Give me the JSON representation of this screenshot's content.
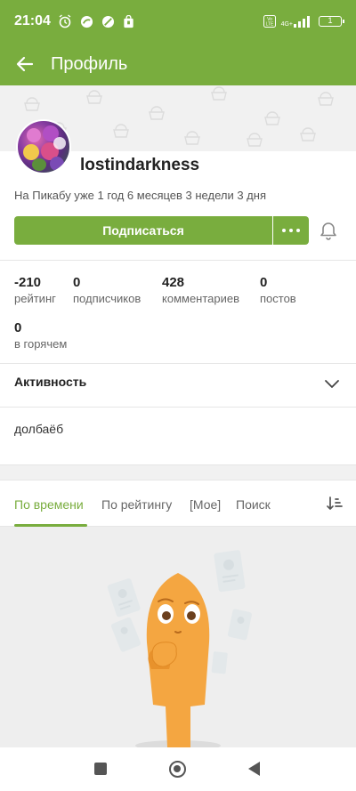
{
  "status_bar": {
    "time": "21:04",
    "signal_text": "4G+",
    "volte": "Vo LTE",
    "battery": "1"
  },
  "app_bar": {
    "title": "Профиль",
    "back_icon": "arrow-left-icon"
  },
  "profile": {
    "username": "lostindarkness",
    "since": "На Пикабу уже 1 год 6 месяцев 3 недели 3 дня",
    "subscribe_label": "Подписаться",
    "more_icon": "more-dots-icon",
    "bell_icon": "bell-icon"
  },
  "stats": [
    {
      "value": "-210",
      "label": "рейтинг"
    },
    {
      "value": "0",
      "label": "подписчиков"
    },
    {
      "value": "428",
      "label": "комментариев"
    },
    {
      "value": "0",
      "label": "постов"
    },
    {
      "value": "0",
      "label": "в горячем"
    }
  ],
  "activity": {
    "label": "Активность",
    "icon": "chevron-down-icon"
  },
  "bio": "долбаёб",
  "tabs": [
    {
      "label": "По времени",
      "active": true
    },
    {
      "label": "По рейтингу",
      "active": false
    },
    {
      "label": "[Мое]",
      "active": false
    },
    {
      "label": "Поиск",
      "active": false
    }
  ],
  "sort_icon": "sort-icon",
  "colors": {
    "accent": "#79ad3e",
    "background_gray": "#eeeeee",
    "mascot": "#f4a641"
  }
}
